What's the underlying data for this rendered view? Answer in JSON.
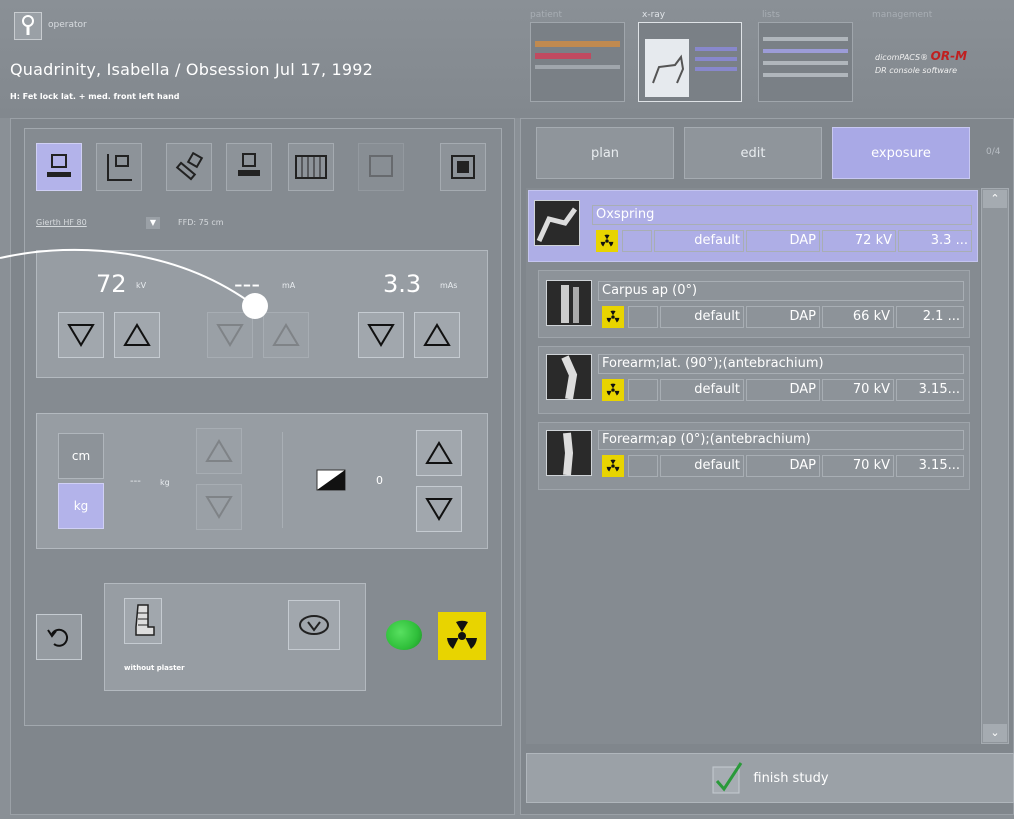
{
  "header": {
    "operator_label": "operator",
    "patient": "Quadrinity, Isabella / Obsession  Jul 17, 1992",
    "exam": "H: Fet lock lat. + med. front left hand",
    "nav": [
      "patient",
      "x-ray",
      "lists",
      "management"
    ],
    "brand_line1": "dicomPACS®",
    "brand_line2": "DR console software",
    "brand_logo": "OR-M"
  },
  "left": {
    "generator": "Gierth HF 80",
    "ffd": "FFD: 75 cm",
    "kv": {
      "value": "72",
      "unit": "kV"
    },
    "ma": {
      "value": "---",
      "unit": "mA"
    },
    "mas": {
      "value": "3.3",
      "unit": "mAs"
    },
    "units": {
      "cm": "cm",
      "kg": "kg"
    },
    "weight": {
      "value": "---",
      "unit": "kg"
    },
    "density": "0",
    "plaster": "without plaster"
  },
  "tabs": {
    "plan": "plan",
    "edit": "edit",
    "exposure": "exposure",
    "count": "0/4"
  },
  "exposures": [
    {
      "name": "Oxspring",
      "mode": "default",
      "dap": "DAP",
      "kv": "72 kV",
      "mas": "3.3 ..."
    },
    {
      "name": "Carpus ap (0°)",
      "mode": "default",
      "dap": "DAP",
      "kv": "66 kV",
      "mas": "2.1 ..."
    },
    {
      "name": "Forearm;lat. (90°);(antebrachium)",
      "mode": "default",
      "dap": "DAP",
      "kv": "70 kV",
      "mas": "3.15..."
    },
    {
      "name": "Forearm;ap (0°);(antebrachium)",
      "mode": "default",
      "dap": "DAP",
      "kv": "70 kV",
      "mas": "3.15..."
    }
  ],
  "finish": "finish study",
  "colors": {
    "accent": "#b3b3ea",
    "radiation": "#e8d400",
    "ready": "#2fbf3a"
  }
}
